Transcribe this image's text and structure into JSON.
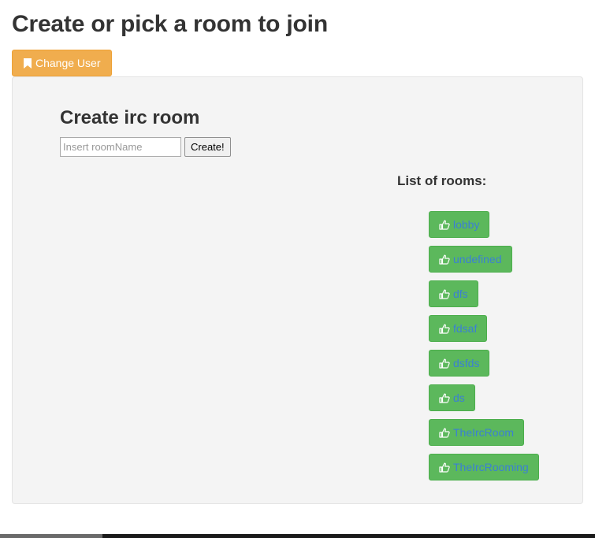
{
  "page": {
    "title": "Create or pick a room to join",
    "change_user_label": "Change User"
  },
  "create_room": {
    "heading": "Create irc room",
    "input_placeholder": "Insert roomName",
    "input_value": "",
    "create_button_label": "Create!"
  },
  "rooms": {
    "heading": "List of rooms:",
    "items": [
      {
        "label": "lobby"
      },
      {
        "label": "undefined"
      },
      {
        "label": "dfs"
      },
      {
        "label": "fdsaf"
      },
      {
        "label": "dsfds"
      },
      {
        "label": "ds"
      },
      {
        "label": "TheIrcRoom"
      },
      {
        "label": "TheIrcRooming"
      }
    ]
  },
  "icons": {
    "change_user": "bookmark-icon",
    "room_button": "thumbs-up-icon"
  },
  "colors": {
    "warning": "#f0ad4e",
    "success": "#5cb85c",
    "link": "#3b7fd4",
    "panel": "#f4f4f4"
  }
}
